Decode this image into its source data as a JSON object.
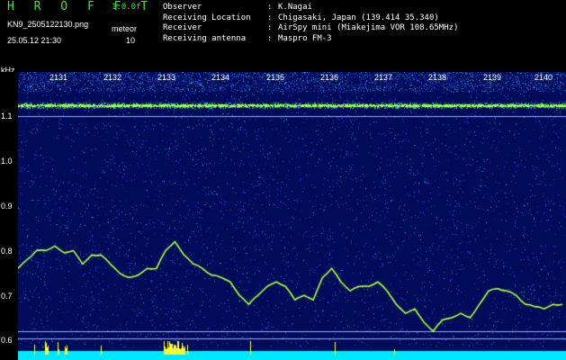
{
  "header": {
    "app_title": "H R O F F T",
    "version": "1.0.0f",
    "filename": "KN9_2505122130.png",
    "datetime": "25.05.12 21:30",
    "meteor_label": "meteor",
    "meteor_count": "10"
  },
  "info": [
    {
      "key": "Observer",
      "sep": ":",
      "value": "K.Nagai"
    },
    {
      "key": "Receiving Location",
      "sep": ":",
      "value": "Chigasaki, Japan (139.414 35.340)"
    },
    {
      "key": "Receiver",
      "sep": ":",
      "value": "AirSpy mini (Miakejima VOR 108.65MHz)"
    },
    {
      "key": "Receiving antenna",
      "sep": ":",
      "value": "Maspro FM-3"
    }
  ],
  "colors": {
    "title": "#33ee33",
    "background": "#000000",
    "noise_base": "#000c5a",
    "signal": "#7dff3a",
    "meteor_trace": "#ffff30",
    "baseline": "#00e8ff",
    "guide_line": "#9aa8ff"
  },
  "chart_data": {
    "type": "heatmap",
    "ylabel": "kHz",
    "x_ticks": [
      "2131",
      "2132",
      "2133",
      "2134",
      "2135",
      "2136",
      "2137",
      "2138",
      "2139",
      "2140"
    ],
    "y_ticks": [
      "1.1",
      "1.0",
      "0.9",
      "0.8",
      "0.7",
      "0.6"
    ],
    "carrier_khz": 1.125,
    "guide_lines_khz": [
      1.1,
      0.62,
      0.605
    ],
    "trace_khz": [
      0.76,
      0.78,
      0.8,
      0.8,
      0.81,
      0.795,
      0.8,
      0.77,
      0.79,
      0.79,
      0.77,
      0.75,
      0.74,
      0.745,
      0.76,
      0.76,
      0.8,
      0.82,
      0.79,
      0.77,
      0.76,
      0.745,
      0.74,
      0.73,
      0.7,
      0.68,
      0.7,
      0.72,
      0.73,
      0.72,
      0.69,
      0.7,
      0.69,
      0.74,
      0.76,
      0.73,
      0.71,
      0.72,
      0.72,
      0.73,
      0.71,
      0.68,
      0.66,
      0.67,
      0.64,
      0.62,
      0.645,
      0.65,
      0.66,
      0.65,
      0.68,
      0.71,
      0.715,
      0.71,
      0.7,
      0.68,
      0.675,
      0.67,
      0.68,
      0.68
    ]
  }
}
